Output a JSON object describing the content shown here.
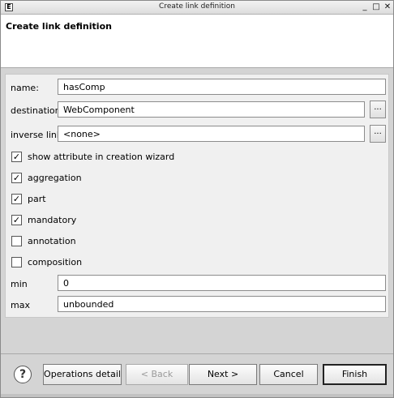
{
  "window": {
    "icon_glyph": "E",
    "title": "Create link definition",
    "controls": [
      "_",
      "□",
      "✕"
    ]
  },
  "header": {
    "title": "Create link definition"
  },
  "form": {
    "name_label": "name:",
    "name_value": "hasComp",
    "destination_label": "destination",
    "destination_value": "WebComponent",
    "inverse_link_label": "inverse link",
    "inverse_link_value": "<none>",
    "browse_label": "...",
    "checkboxes": [
      {
        "label": "show attribute in creation wizard",
        "checked": true
      },
      {
        "label": "aggregation",
        "checked": true
      },
      {
        "label": "part",
        "checked": true
      },
      {
        "label": "mandatory",
        "checked": true
      },
      {
        "label": "annotation",
        "checked": false
      },
      {
        "label": "composition",
        "checked": false
      }
    ],
    "check_glyph": "✓",
    "min_label": "min",
    "min_value": "0",
    "max_label": "max",
    "max_value": "unbounded"
  },
  "buttons": {
    "help_glyph": "?",
    "operations_detail": "Operations detail",
    "back": "< Back",
    "next": "Next >",
    "cancel": "Cancel",
    "finish": "Finish"
  }
}
